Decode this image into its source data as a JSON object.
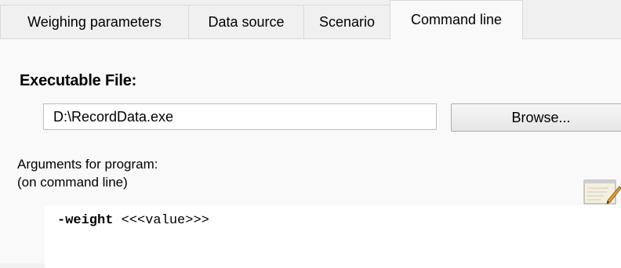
{
  "tabs": [
    {
      "label": "Weighing parameters"
    },
    {
      "label": "Data source"
    },
    {
      "label": "Scenario"
    },
    {
      "label": "Command line",
      "active": true
    }
  ],
  "executable": {
    "label": "Executable File:",
    "value": "D:\\RecordData.exe",
    "browse_label": "Browse..."
  },
  "arguments": {
    "label_line1": "Arguments for program:",
    "label_line2": "(on command line)",
    "edit_icon": "notepad-pencil-icon",
    "value_bold": "-weight",
    "value_rest": " <<<value>>>"
  }
}
